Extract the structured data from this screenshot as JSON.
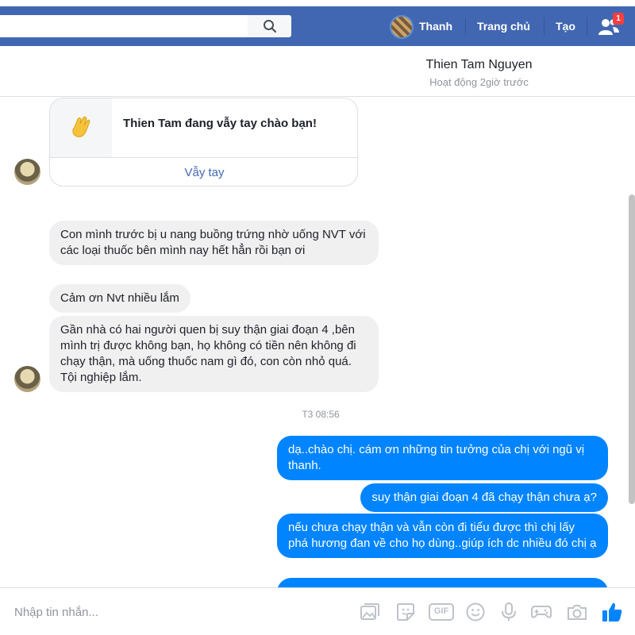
{
  "nav": {
    "search_placeholder": "",
    "search_value": "",
    "profile_name": "Thanh",
    "home_label": "Trang chủ",
    "create_label": "Tạo",
    "friend_requests_count": "1"
  },
  "conversation": {
    "name": "Thien Tam Nguyen",
    "status": "Hoạt động 2giờ trước"
  },
  "wave": {
    "text": "Thien Tam đang vẫy tay chào bạn!",
    "button_label": "Vẫy tay"
  },
  "messages_in": [
    "Con mình trước bị u nang buồng trứng nhờ uống NVT với các loại thuốc bên mình nay hết hẳn rồi bạn ơi",
    "Cảm ơn Nvt nhiều lắm",
    "Gần nhà có hai người quen bị suy thận giai đoạn 4 ,bên mình trị được không bạn, họ không có tiền nên không đi chạy thận, mà uống thuốc nam gì đó, con còn nhỏ quá. Tội nghiệp lắm."
  ],
  "timestamp": "T3 08:56",
  "messages_out": [
    "dạ..chào chị. cám ơn những tin tưởng của chị với ngũ vị thanh.",
    "suy thận giai đoạn 4 đã chạy thận chưa ạ?",
    "nếu chưa chạy thận và vẫn còn đi tiểu được thì chị lấy phá hương đan về cho họ dùng..giúp ích dc nhiều đó chị ạ"
  ],
  "composer": {
    "placeholder": "Nhập tin nhắn...",
    "gif_label": "GIF"
  },
  "colors": {
    "nav_blue": "#4267b2",
    "outgoing_bubble": "#0084ff",
    "incoming_bubble": "#f1f0f0",
    "badge_red": "#fa3e3e"
  }
}
